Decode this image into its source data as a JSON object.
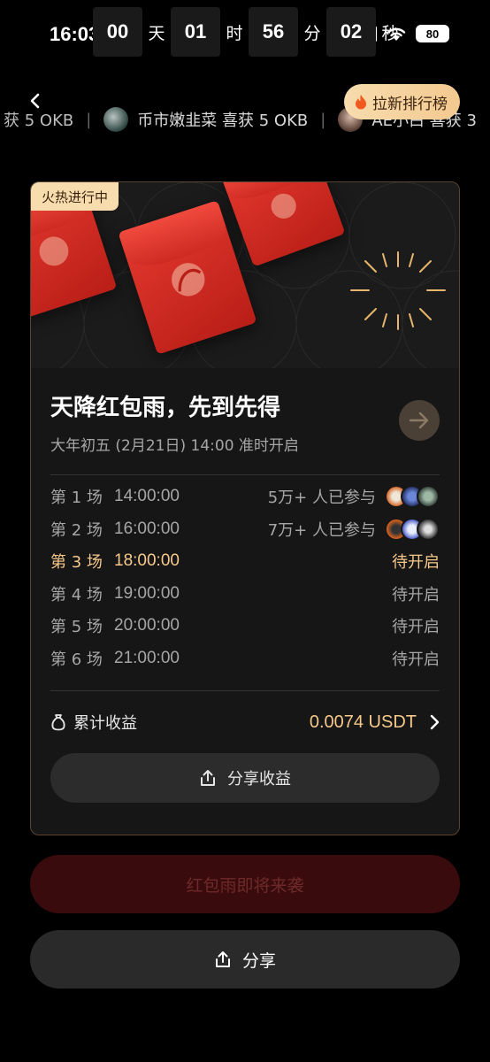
{
  "status_bar": {
    "time": "16:03",
    "battery": "80"
  },
  "countdown": {
    "days": "00",
    "days_unit": "天",
    "hours": "01",
    "hours_unit": "时",
    "minutes": "56",
    "minutes_unit": "分",
    "seconds": "02",
    "seconds_unit": "秒"
  },
  "ticker": {
    "items": [
      {
        "text": "获 5 OKB"
      },
      {
        "text": "币市嫩韭菜 喜获 5 OKB"
      },
      {
        "text": "AE小白 喜获 3"
      }
    ]
  },
  "rank_button": {
    "label": "拉新排行榜"
  },
  "card": {
    "tag": "火热进行中",
    "title": "天降红包雨，先到先得",
    "subtitle": "大年初五 (2月21日) 14:00 准时开启",
    "sessions": [
      {
        "name": "第 1 场",
        "time": "14:00:00",
        "status": "5万+ 人已参与",
        "has_avatars": true
      },
      {
        "name": "第 2 场",
        "time": "16:00:00",
        "status": "7万+ 人已参与",
        "has_avatars": true
      },
      {
        "name": "第 3 场",
        "time": "18:00:00",
        "status": "待开启",
        "active": true
      },
      {
        "name": "第 4 场",
        "time": "19:00:00",
        "status": "待开启"
      },
      {
        "name": "第 5 场",
        "time": "20:00:00",
        "status": "待开启"
      },
      {
        "name": "第 6 场",
        "time": "21:00:00",
        "status": "待开启"
      }
    ],
    "earnings_label": "累计收益",
    "earnings_value": "0.0074 USDT",
    "share_earnings_label": "分享收益"
  },
  "buttons": {
    "rain_label": "红包雨即将来袭",
    "share_label": "分享"
  },
  "colors": {
    "accent_gold": "#f7c98b",
    "tag_bg": "#f7dcae",
    "envelope_red": "#d9302a"
  }
}
